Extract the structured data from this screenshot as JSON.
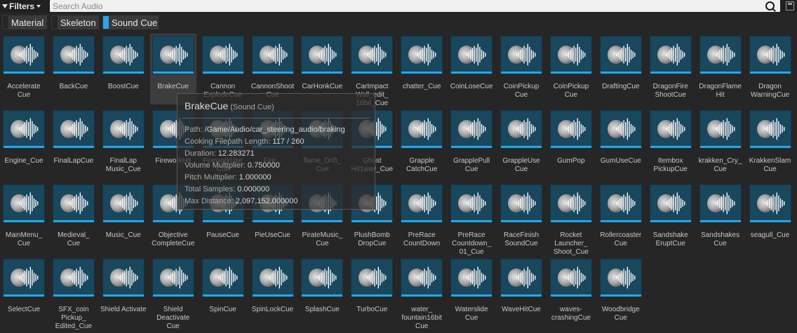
{
  "toolbar": {
    "filters_label": "Filters",
    "search_placeholder": "Search Audio",
    "search_icon": "search-icon",
    "save_icon": "save-icon"
  },
  "filter_chips": [
    {
      "label": "Material",
      "active": false
    },
    {
      "label": "Skeleton",
      "active": false
    },
    {
      "label": "Sound Cue",
      "active": true
    }
  ],
  "colors": {
    "accent": "#27a6e6",
    "thumb_bg": "#18475e",
    "background": "#262626"
  },
  "assets": [
    {
      "label": "Accelerate Cue"
    },
    {
      "label": "BackCue"
    },
    {
      "label": "BoostCue"
    },
    {
      "label": "BrakeCue"
    },
    {
      "label": "Cannon ExplodeCue"
    },
    {
      "label": "CannonShoot Cue"
    },
    {
      "label": "CarHonkCue"
    },
    {
      "label": "CarImpact Wall_edit_ 16bit_Cue"
    },
    {
      "label": "chatter_Cue"
    },
    {
      "label": "CoinLoseCue"
    },
    {
      "label": "CoinPickup Cue"
    },
    {
      "label": "CoinPickup Cue"
    },
    {
      "label": "DraftingCue"
    },
    {
      "label": "DragonFire ShootCue"
    },
    {
      "label": "DragonFlame Hit"
    },
    {
      "label": "Dragon WarningCue"
    },
    {
      "label": "Engine_Cue"
    },
    {
      "label": "FinalLapCue"
    },
    {
      "label": "FinalLap Music_Cue"
    },
    {
      "label": "FireworkHit"
    },
    {
      "label": "FireworkUse Cue"
    },
    {
      "label": "Fire..."
    },
    {
      "label": "flame_Drift_ Cue"
    },
    {
      "label": "Ghost Hit1wav_Cue"
    },
    {
      "label": "Grapple CatchCue"
    },
    {
      "label": "GrapplePull Cue"
    },
    {
      "label": "GrappleUse Cue"
    },
    {
      "label": "GumPop"
    },
    {
      "label": "GumUseCue"
    },
    {
      "label": "Itembox PickupCue"
    },
    {
      "label": "krakken_Cry_ Cue"
    },
    {
      "label": "KrakkenSlam Cue"
    },
    {
      "label": "MainMenu_ Cue"
    },
    {
      "label": "Medieval_ Cue"
    },
    {
      "label": "Music_Cue"
    },
    {
      "label": "Objective CompleteCue"
    },
    {
      "label": "PauseCue"
    },
    {
      "label": "PieUseCue"
    },
    {
      "label": "PirateMusic_ Cue"
    },
    {
      "label": "PlushBomb DropCue"
    },
    {
      "label": "PreRace CountDown"
    },
    {
      "label": "PreRace Countdown_ 01_Cue"
    },
    {
      "label": "RaceFinish SoundCue"
    },
    {
      "label": "Rocket Launcher_ Shoot_Cue"
    },
    {
      "label": "Rollercoaster Cue"
    },
    {
      "label": "Sandshake EruptCue"
    },
    {
      "label": "Sandshakes Cue"
    },
    {
      "label": "seagull_Cue"
    },
    {
      "label": "SelectCue"
    },
    {
      "label": "SFX_coin Pickup_ Edited_Cue"
    },
    {
      "label": "Shield Activate"
    },
    {
      "label": "Shield Deactivate Cue"
    },
    {
      "label": "SpinCue"
    },
    {
      "label": "SpinLockCue"
    },
    {
      "label": "SplashCue"
    },
    {
      "label": "TurboCue"
    },
    {
      "label": "water_ fountain16bit Cue"
    },
    {
      "label": "Waterslide Cue"
    },
    {
      "label": "WaveHitCue"
    },
    {
      "label": "waves- crashingCue"
    },
    {
      "label": "Woodbridge Cue"
    }
  ],
  "selected_asset": "BrakeCue",
  "tooltip": {
    "title": "BrakeCue",
    "subtitle": "(Sound Cue)",
    "rows": [
      {
        "key": "Path:",
        "value": "/Game/Audio/car_steering_audio/braking"
      },
      {
        "key": "Cooking Filepath Length:",
        "value": "117 / 260"
      },
      {
        "key": "Duration:",
        "value": "12.283271"
      },
      {
        "key": "Volume Multiplier:",
        "value": "0.750000"
      },
      {
        "key": "Pitch Multiplier:",
        "value": "1.000000"
      },
      {
        "key": "Total Samples:",
        "value": "0.000000"
      },
      {
        "key": "Max Distance:",
        "value": "2,097,152.000000"
      }
    ]
  }
}
